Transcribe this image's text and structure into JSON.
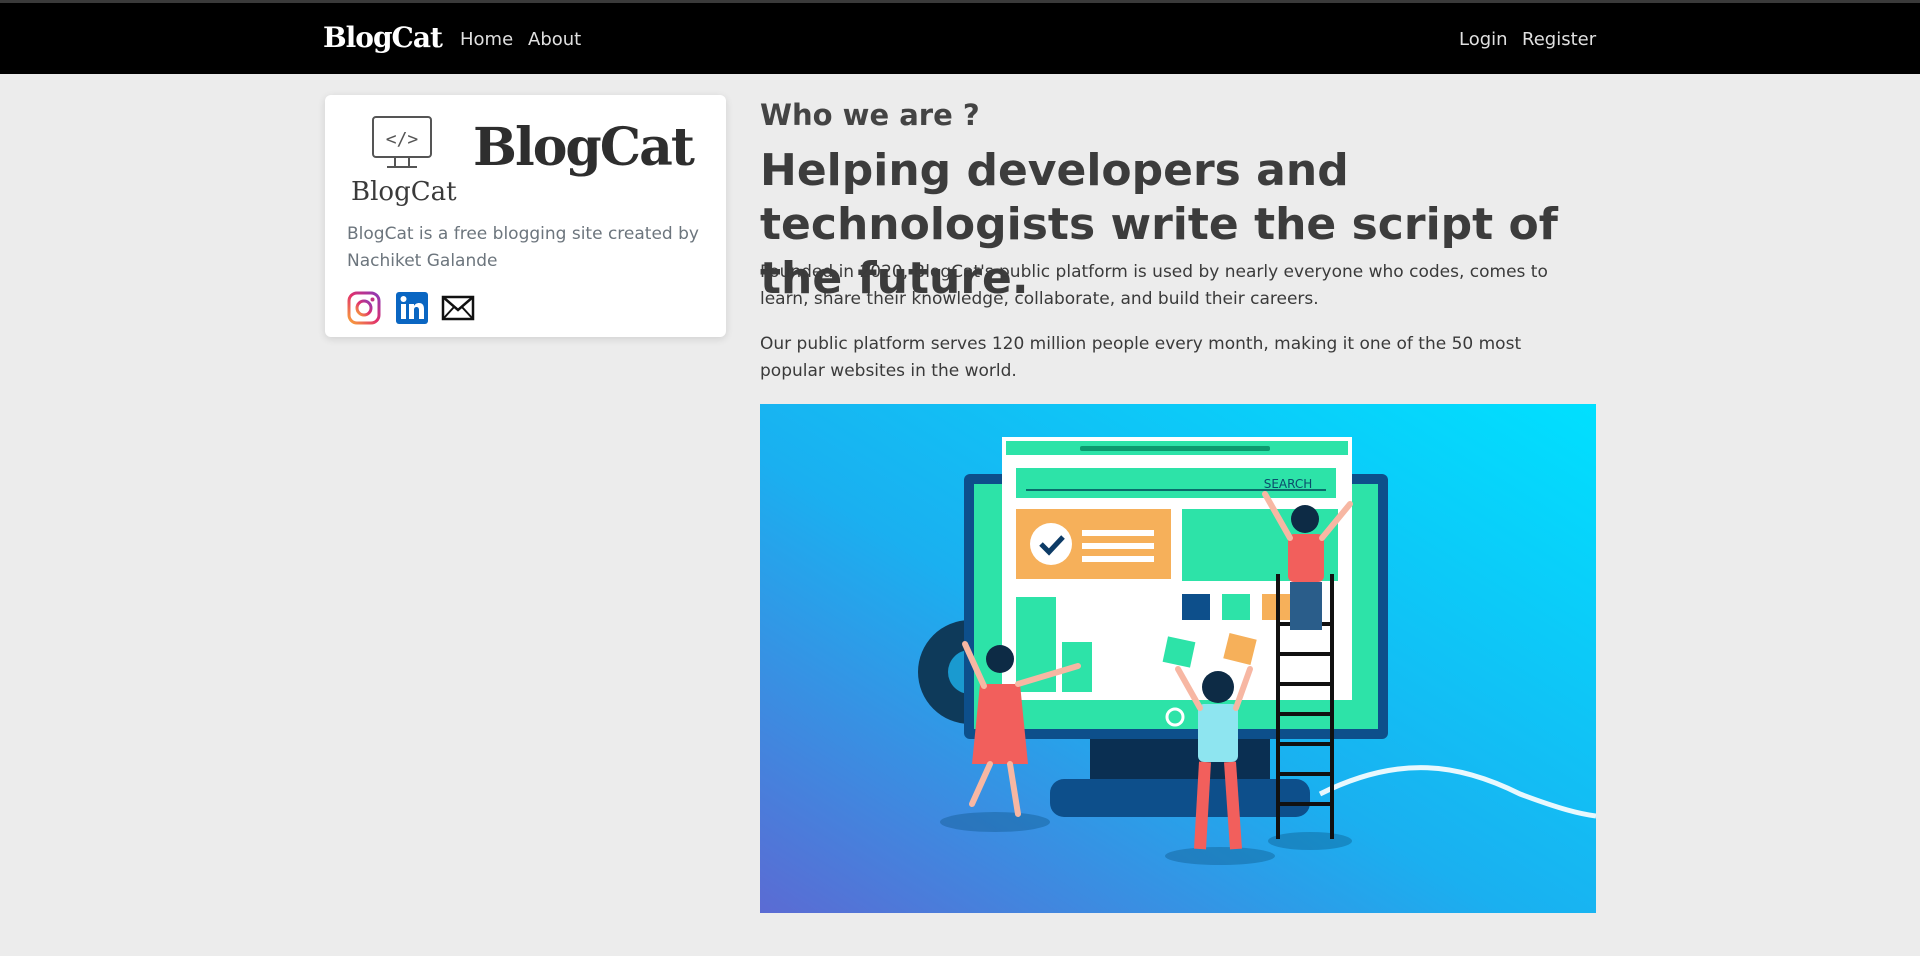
{
  "navbar": {
    "brand": "BlogCat",
    "links": {
      "home": "Home",
      "about": "About",
      "login": "Login",
      "register": "Register"
    }
  },
  "profile_card": {
    "logo_small_text": "BlogCat",
    "logo_code_glyph": "</>",
    "logo_big_text": "BlogCat",
    "description": "BlogCat is a free blogging site created by Nachiket Galande",
    "social_icons": [
      "instagram-icon",
      "linkedin-icon",
      "mail-icon"
    ]
  },
  "main": {
    "subheading": "Who we are ?",
    "headline": "Helping developers and technologists write the script of the future.",
    "paragraph_1": "Founded in 2020, BlogCat's public platform is used by nearly everyone who codes, comes to learn, share their knowledge, collaborate, and build their careers.",
    "paragraph_2": "Our public platform serves 120 million people every month, making it one of the 50 most popular websites in the world.",
    "illustration": {
      "search_label": "SEARCH"
    }
  },
  "colors": {
    "navbar_bg": "#000000",
    "page_bg": "#ececec",
    "hero_gradient": [
      "#5b6bd3",
      "#00e0ff"
    ],
    "accent_green": "#2de3a8",
    "accent_orange": "#f6b05a"
  }
}
